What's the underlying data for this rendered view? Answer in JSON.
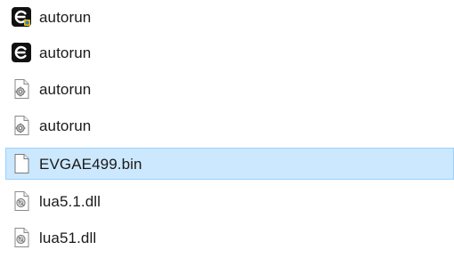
{
  "files": [
    {
      "name": "autorun",
      "icon": "app-exe-icon",
      "selected": false
    },
    {
      "name": "autorun",
      "icon": "app-exe-icon",
      "selected": false
    },
    {
      "name": "autorun",
      "icon": "config-file-icon",
      "selected": false
    },
    {
      "name": "autorun",
      "icon": "config-file-icon",
      "selected": false
    },
    {
      "name": "EVGAE499.bin",
      "icon": "blank-file-icon",
      "selected": true
    },
    {
      "name": "lua5.1.dll",
      "icon": "dll-file-icon",
      "selected": false
    },
    {
      "name": "lua51.dll",
      "icon": "dll-file-icon",
      "selected": false
    }
  ],
  "colors": {
    "selection_background": "#cce8ff",
    "selection_border": "#99d1ff",
    "text": "#1a1a1a"
  }
}
